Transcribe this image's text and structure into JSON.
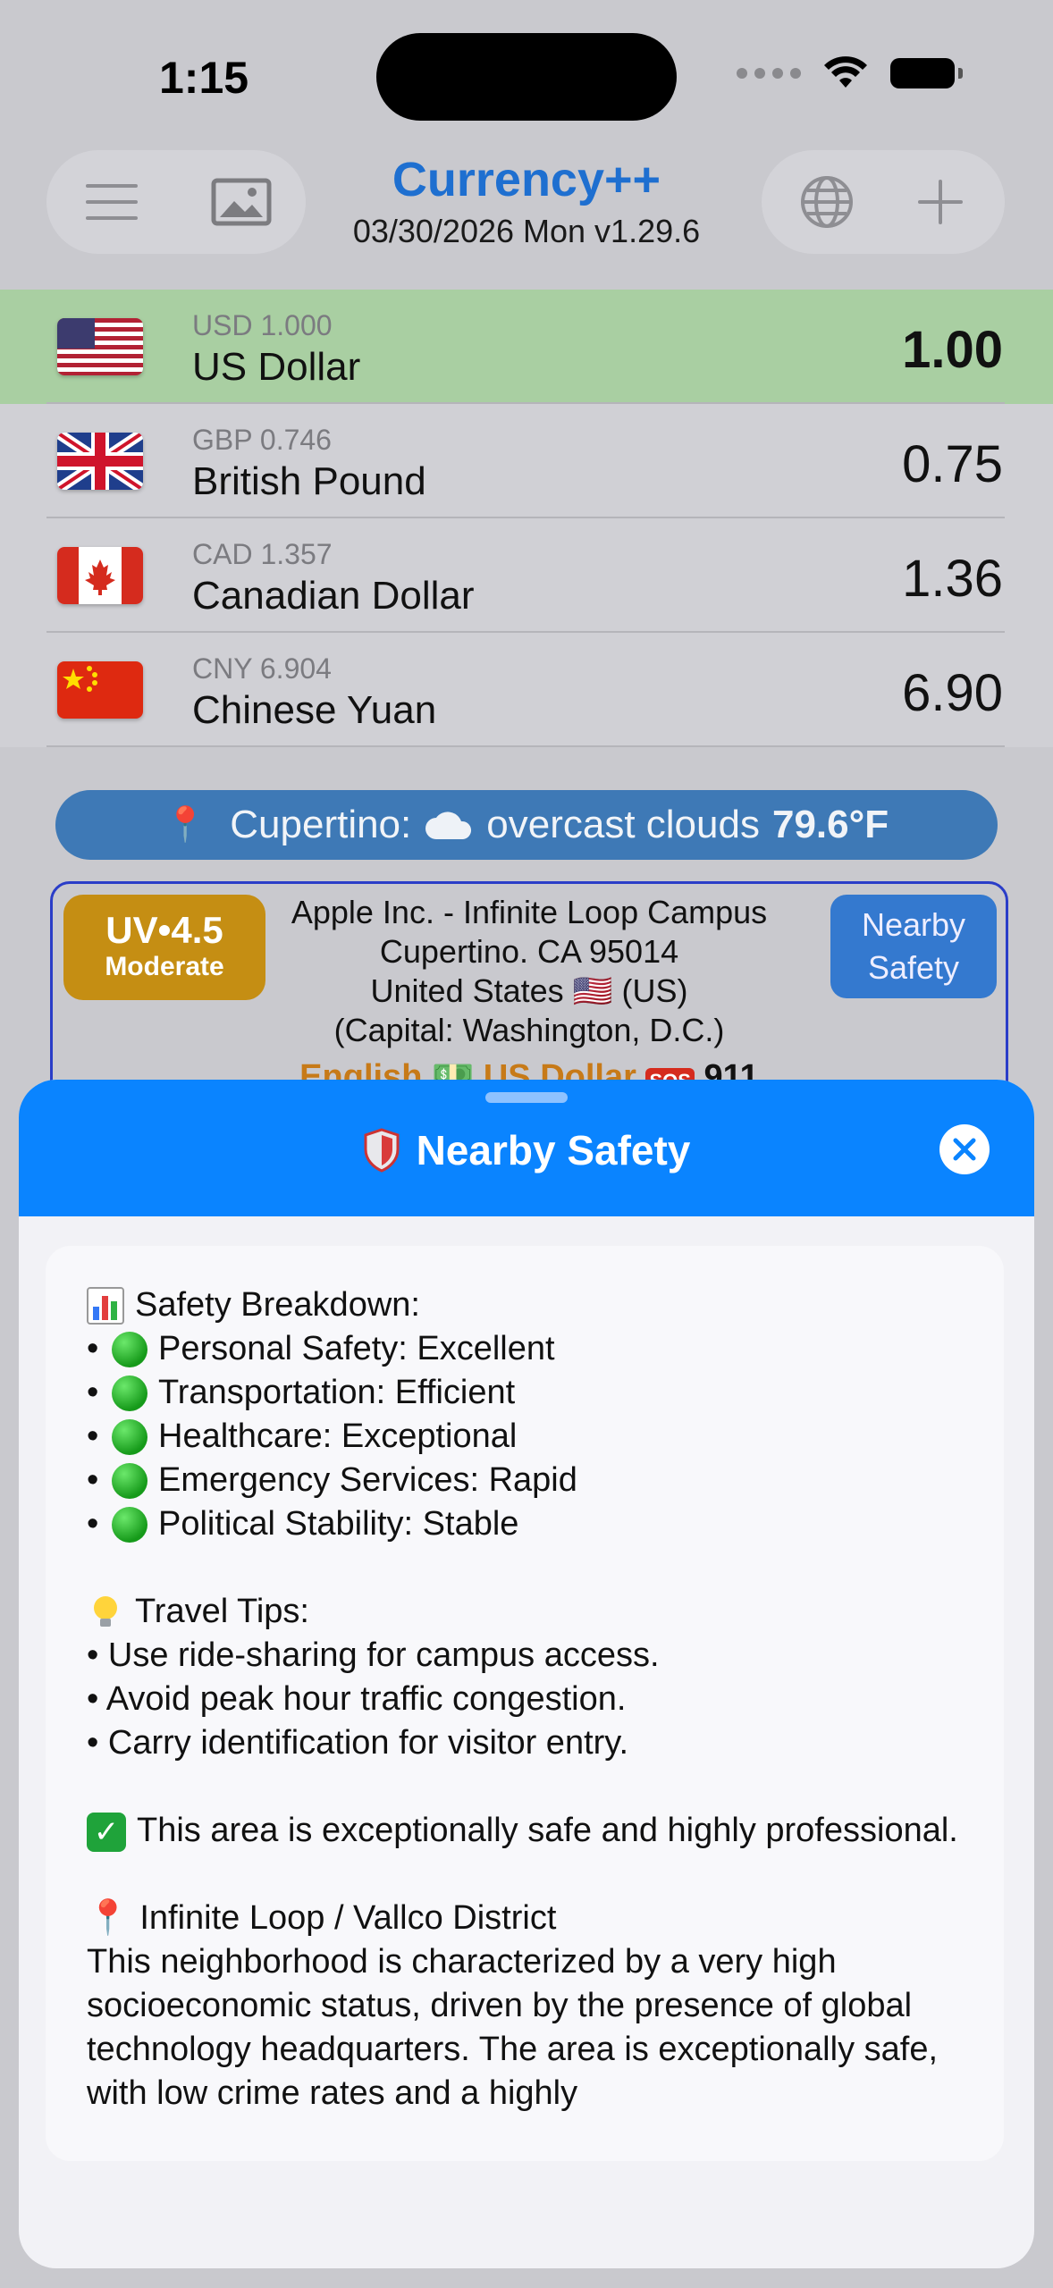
{
  "status": {
    "time": "1:15"
  },
  "header": {
    "title": "Currency++",
    "subtitle": "03/30/2026 Mon v1.29.6"
  },
  "currencies": [
    {
      "code": "USD",
      "rate": "1.000",
      "name": "US Dollar",
      "amount": "1.00",
      "selected": true
    },
    {
      "code": "GBP",
      "rate": "0.746",
      "name": "British Pound",
      "amount": "0.75"
    },
    {
      "code": "CAD",
      "rate": "1.357",
      "name": "Canadian Dollar",
      "amount": "1.36"
    },
    {
      "code": "CNY",
      "rate": "6.904",
      "name": "Chinese Yuan",
      "amount": "6.90"
    }
  ],
  "weather": {
    "city": "Cupertino:",
    "condition": "overcast clouds",
    "temp": "79.6°F"
  },
  "location": {
    "uv_value": "UV•4.5",
    "uv_label": "Moderate",
    "line1": "Apple Inc. - Infinite Loop Campus",
    "line2": "Cupertino. CA 95014",
    "line3": "United States 🇺🇸 (US)",
    "line4": "(Capital: Washington, D.C.)",
    "language": "English",
    "currency": "US Dollar",
    "emergency": "911",
    "nearby_button": "Nearby Safety"
  },
  "sheet": {
    "title": "Nearby Safety",
    "breakdown_title": "Safety Breakdown:",
    "breakdown": [
      "Personal Safety: Excellent",
      "Transportation: Efficient",
      "Healthcare: Exceptional",
      "Emergency Services: Rapid",
      "Political Stability: Stable"
    ],
    "tips_title": "Travel Tips:",
    "tips": [
      "Use ride-sharing for campus access.",
      "Avoid peak hour traffic congestion.",
      "Carry identification for visitor entry."
    ],
    "summary": "This area is exceptionally safe and highly professional.",
    "district_title": "Infinite Loop / Vallco District",
    "district_text": "This neighborhood is characterized by a very high socioeconomic status, driven by the presence of global technology headquarters. The area is exceptionally safe, with low crime rates and a highly"
  },
  "colors": {
    "accent": "#0a84ff",
    "title_blue": "#1e6fd0",
    "selected_row": "#a9cfa2",
    "weather_bar": "#3e79b6",
    "uv_badge": "#c58e13"
  },
  "icons": [
    "menu-icon",
    "image-icon",
    "globe-icon",
    "plus-icon",
    "pin-icon",
    "cloud-icon",
    "shield-icon",
    "close-icon",
    "chart-icon",
    "bulb-icon",
    "check-icon"
  ]
}
